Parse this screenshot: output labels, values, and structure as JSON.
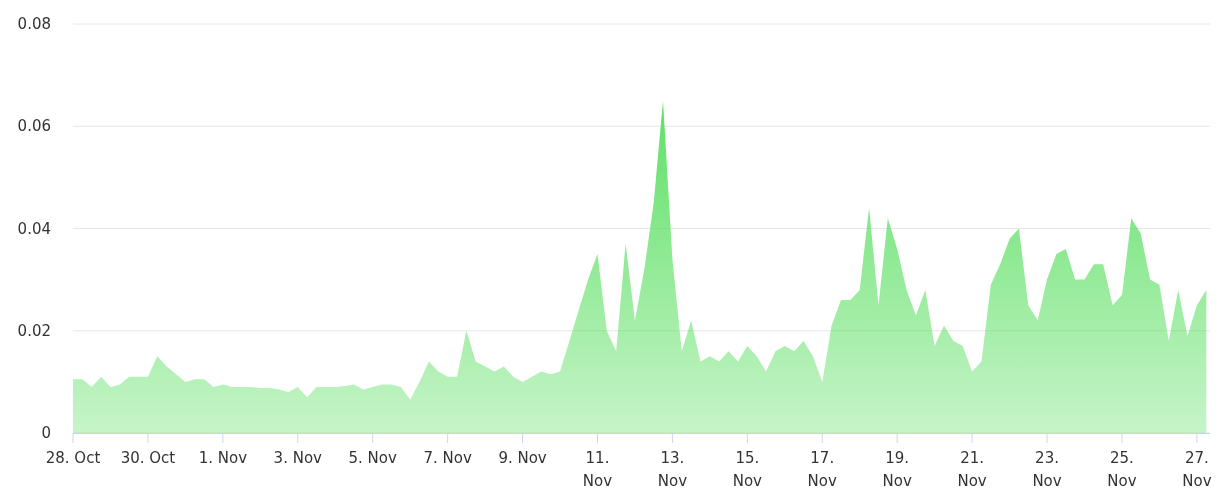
{
  "chart": {
    "chart_data": {
      "type": "area",
      "categories": [
        "28. Oct",
        null,
        null,
        null,
        null,
        null,
        null,
        null,
        "30. Oct",
        null,
        null,
        null,
        null,
        null,
        null,
        null,
        "1. Nov",
        null,
        null,
        null,
        null,
        null,
        null,
        null,
        "3. Nov",
        null,
        null,
        null,
        null,
        null,
        null,
        null,
        "5. Nov",
        null,
        null,
        null,
        null,
        null,
        null,
        null,
        "7. Nov",
        null,
        null,
        null,
        null,
        null,
        null,
        null,
        "9. Nov",
        null,
        null,
        null,
        null,
        null,
        null,
        null,
        "11.\nNov",
        null,
        null,
        null,
        null,
        null,
        null,
        null,
        "13.\nNov",
        null,
        null,
        null,
        null,
        null,
        null,
        null,
        "15.\nNov",
        null,
        null,
        null,
        null,
        null,
        null,
        null,
        "17.\nNov",
        null,
        null,
        null,
        null,
        null,
        null,
        null,
        "19.\nNov",
        null,
        null,
        null,
        null,
        null,
        null,
        null,
        "21.\nNov",
        null,
        null,
        null,
        null,
        null,
        null,
        null,
        "23.\nNov",
        null,
        null,
        null,
        null,
        null,
        null,
        null,
        "25.\nNov",
        null,
        null,
        null,
        null,
        null,
        null,
        null,
        "27.\nNov",
        null
      ],
      "series": [
        {
          "color": "#5ee065",
          "values": [
            0.0105,
            0.0105,
            0.009,
            0.011,
            0.009,
            0.0095,
            0.011,
            0.011,
            0.011,
            0.015,
            0.013,
            0.0115,
            0.01,
            0.0105,
            0.0105,
            0.009,
            0.0095,
            0.009,
            0.009,
            0.009,
            0.0088,
            0.0088,
            0.0085,
            0.008,
            0.009,
            0.007,
            0.009,
            0.009,
            0.009,
            0.0092,
            0.0095,
            0.0085,
            0.009,
            0.0095,
            0.0095,
            0.009,
            0.0065,
            0.01,
            0.014,
            0.012,
            0.011,
            0.011,
            0.02,
            0.014,
            0.013,
            0.012,
            0.013,
            0.011,
            0.01,
            0.011,
            0.012,
            0.0115,
            0.012,
            0.018,
            0.024,
            0.03,
            0.035,
            0.02,
            0.016,
            0.037,
            0.022,
            0.032,
            0.045,
            0.065,
            0.034,
            0.016,
            0.022,
            0.014,
            0.015,
            0.014,
            0.016,
            0.014,
            0.017,
            0.015,
            0.012,
            0.016,
            0.017,
            0.016,
            0.018,
            0.015,
            0.01,
            0.021,
            0.026,
            0.026,
            0.028,
            0.044,
            0.025,
            0.042,
            0.036,
            0.028,
            0.023,
            0.028,
            0.017,
            0.021,
            0.018,
            0.017,
            0.012,
            0.014,
            0.029,
            0.033,
            0.038,
            0.04,
            0.025,
            0.022,
            0.03,
            0.035,
            0.036,
            0.03,
            0.03,
            0.033,
            0.033,
            0.025,
            0.027,
            0.042,
            0.039,
            0.03,
            0.029,
            0.018,
            0.028,
            0.019,
            0.025,
            0.028
          ]
        }
      ],
      "ylim": [
        0,
        0.08
      ],
      "grid": true,
      "yticks": [
        {
          "value": 0,
          "label": "0"
        },
        {
          "value": 0.02,
          "label": "0.02"
        },
        {
          "value": 0.04,
          "label": "0.04"
        },
        {
          "value": 0.06,
          "label": "0.06"
        },
        {
          "value": 0.08,
          "label": "0.08"
        }
      ]
    }
  }
}
